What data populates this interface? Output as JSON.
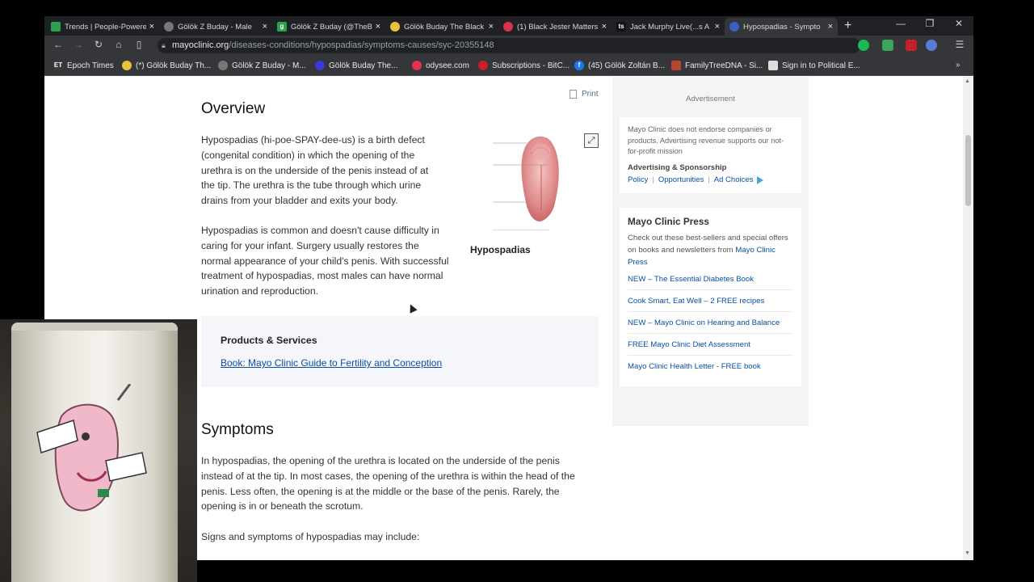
{
  "browser": {
    "tabs": [
      {
        "title": "Trends | People-Powere",
        "favicon": "green",
        "active": false
      },
      {
        "title": "Gölök Z Buday - Male",
        "favicon": "globe",
        "active": false
      },
      {
        "title": "Gölök Z Buday (@TheB",
        "favicon": "green-g",
        "active": false
      },
      {
        "title": "Gölök Buday The Black",
        "favicon": "yellow-bulb",
        "active": false
      },
      {
        "title": "(1) Black Jester Matters",
        "favicon": "red",
        "active": false
      },
      {
        "title": "Jack Murphy Live(...s A",
        "favicon": "ts",
        "active": false
      },
      {
        "title": "Hypospadias - Sympto",
        "favicon": "mayo",
        "active": true
      }
    ],
    "url_domain": "mayoclinic.org",
    "url_path": "/diseases-conditions/hypospadias/symptoms-causes/syc-20355148",
    "bookmarks": [
      {
        "label": "Epoch Times",
        "icon": "ET"
      },
      {
        "label": "(*) Gölök Buday Th...",
        "icon": "bulb"
      },
      {
        "label": "Gölök Z Buday - M...",
        "icon": "globe"
      },
      {
        "label": "Gölök Buday The...",
        "icon": "mask"
      },
      {
        "label": "odysee.com",
        "icon": "odysee"
      },
      {
        "label": "Subscriptions - BitC...",
        "icon": "bitchute"
      },
      {
        "label": "(45) Gölök Zoltán B...",
        "icon": "facebook"
      },
      {
        "label": "FamilyTreeDNA - Si...",
        "icon": "ftdna"
      },
      {
        "label": "Sign in to Political E...",
        "icon": "pe"
      }
    ]
  },
  "article": {
    "overview_title": "Overview",
    "print_label": "Print",
    "para1": "Hypospadias (hi-poe-SPAY-dee-us) is a birth defect (congenital condition) in which the opening of the urethra is on the underside of the penis instead of at the tip. The urethra is the tube through which urine drains from your bladder and exits your body.",
    "para2": "Hypospadias is common and doesn't cause difficulty in caring for your infant. Surgery usually restores the normal appearance of your child's penis. With successful treatment of hypospadias, most males can have normal urination and reproduction.",
    "figure_caption": "Hypospadias",
    "products_heading": "Products & Services",
    "products_link": "Book: Mayo Clinic Guide to Fertility and Conception",
    "symptoms_title": "Symptoms",
    "para3": "In hypospadias, the opening of the urethra is located on the underside of the penis instead of at the tip. In most cases, the opening of the urethra is within the head of the penis. Less often, the opening is at the middle or the base of the penis. Rarely, the opening is in or beneath the scrotum.",
    "para4": "Signs and symptoms of hypospadias may include:"
  },
  "sidebar": {
    "ad_label": "Advertisement",
    "disclaimer": "Mayo Clinic does not endorse companies or products. Advertising revenue supports our not-for-profit mission",
    "ad_sponsorship": "Advertising & Sponsorship",
    "ad_links": {
      "policy": "Policy",
      "opportunities": "Opportunities",
      "ad_choices": "Ad Choices"
    },
    "press_title": "Mayo Clinic Press",
    "press_desc_pre": "Check out these best-sellers and special offers on books and newsletters from ",
    "press_desc_link": "Mayo Clinic Press",
    "press_items": [
      "NEW – The Essential Diabetes Book",
      "Cook Smart, Eat Well – 2 FREE recipes",
      "NEW – Mayo Clinic on Hearing and Balance",
      "FREE Mayo Clinic Diet Assessment",
      "Mayo Clinic Health Letter - FREE book"
    ]
  }
}
